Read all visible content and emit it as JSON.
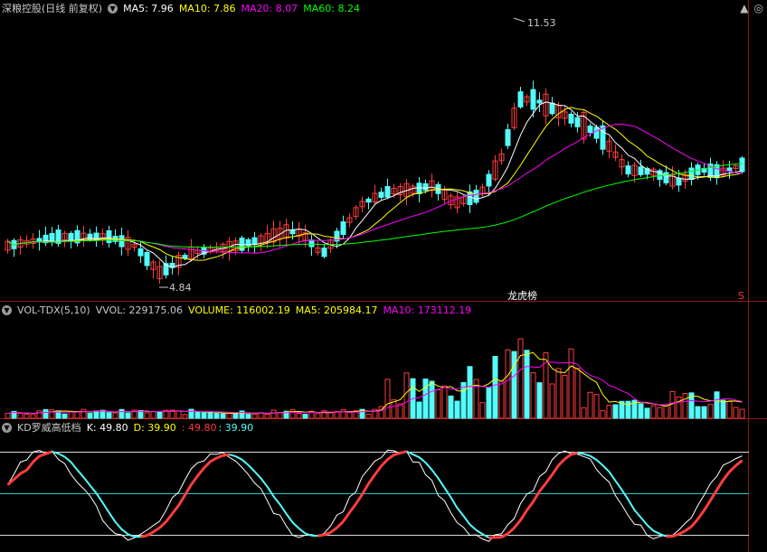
{
  "header": {
    "title": "深粮控股(日线 前复权)",
    "ma5": "MA5: 7.96",
    "ma10": "MA10: 7.86",
    "ma20": "MA20: 8.07",
    "ma60": "MA60: 8.24",
    "icon_up": "▲",
    "icon_down": "◎"
  },
  "price_panel": {
    "high_label": "11.53",
    "low_label": "4.84",
    "tag_lhb": "龙虎榜",
    "tag_s": "S"
  },
  "volume_panel": {
    "title": "VOL-TDX(5,10)",
    "vvol": "VVOL: 229175.06",
    "volume": "VOLUME: 116002.19",
    "ma5": "MA5: 205984.17",
    "ma10": "MA10: 173112.19"
  },
  "kd_panel": {
    "title": "KD罗威高低档",
    "k": "K: 49.80",
    "d": "D: 39.90",
    "v1": ": 49.80",
    "v2": ": 39.90"
  },
  "colors": {
    "up": "#ff3c3c",
    "down": "#54fcfc",
    "ma5": "#ffffff",
    "ma10": "#ffff00",
    "ma20": "#ff00ff",
    "ma60": "#00ff00",
    "grid": "#8b1a1a"
  }
}
